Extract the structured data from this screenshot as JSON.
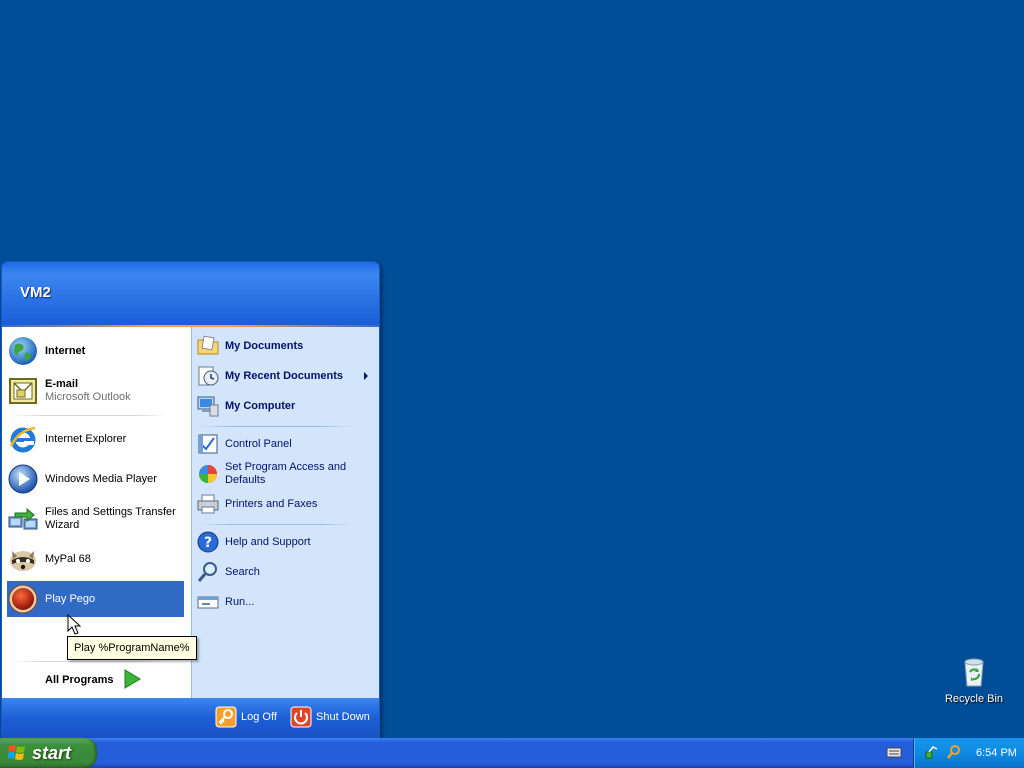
{
  "desktop": {
    "background": "#004e98",
    "recycle_bin_label": "Recycle Bin"
  },
  "start_menu": {
    "user_name": "VM2",
    "pinned": [
      {
        "title": "Internet",
        "icon": "globe-icon"
      },
      {
        "title": "E-mail",
        "subtitle": "Microsoft Outlook",
        "icon": "outlook-icon"
      }
    ],
    "recent": [
      {
        "title": "Internet Explorer",
        "icon": "internet-explorer-icon"
      },
      {
        "title": "Windows Media Player",
        "icon": "media-player-icon"
      },
      {
        "title": "Files and Settings Transfer Wizard",
        "icon": "transfer-wizard-icon"
      },
      {
        "title": "MyPal 68",
        "icon": "mypal-icon"
      },
      {
        "title": "Play Pego",
        "icon": "pego-icon",
        "highlighted": true
      }
    ],
    "all_programs_label": "All Programs",
    "right_items": [
      {
        "title": "My Documents",
        "icon": "folder-documents-icon"
      },
      {
        "title": "My Recent Documents",
        "icon": "recent-documents-icon",
        "has_submenu": true
      },
      {
        "title": "My Computer",
        "icon": "computer-icon"
      },
      {
        "title": "Control Panel",
        "icon": "control-panel-icon"
      },
      {
        "title": "Set Program Access and Defaults",
        "icon": "program-access-icon"
      },
      {
        "title": "Printers and Faxes",
        "icon": "printer-icon"
      },
      {
        "title": "Help and Support",
        "icon": "help-icon"
      },
      {
        "title": "Search",
        "icon": "search-icon"
      },
      {
        "title": "Run...",
        "icon": "run-icon"
      }
    ],
    "log_off_label": "Log Off",
    "shut_down_label": "Shut Down"
  },
  "tooltip": {
    "text": "Play %ProgramName%"
  },
  "taskbar": {
    "start_label": "start",
    "clock": "6:54 PM"
  },
  "colors": {
    "highlight": "#316ac5",
    "right_pane": "#d3e5fa",
    "header": "#1d6ce8",
    "taskbar": "#245edb",
    "start_button": "#3c8f3a",
    "tray": "#0f8ae3"
  }
}
